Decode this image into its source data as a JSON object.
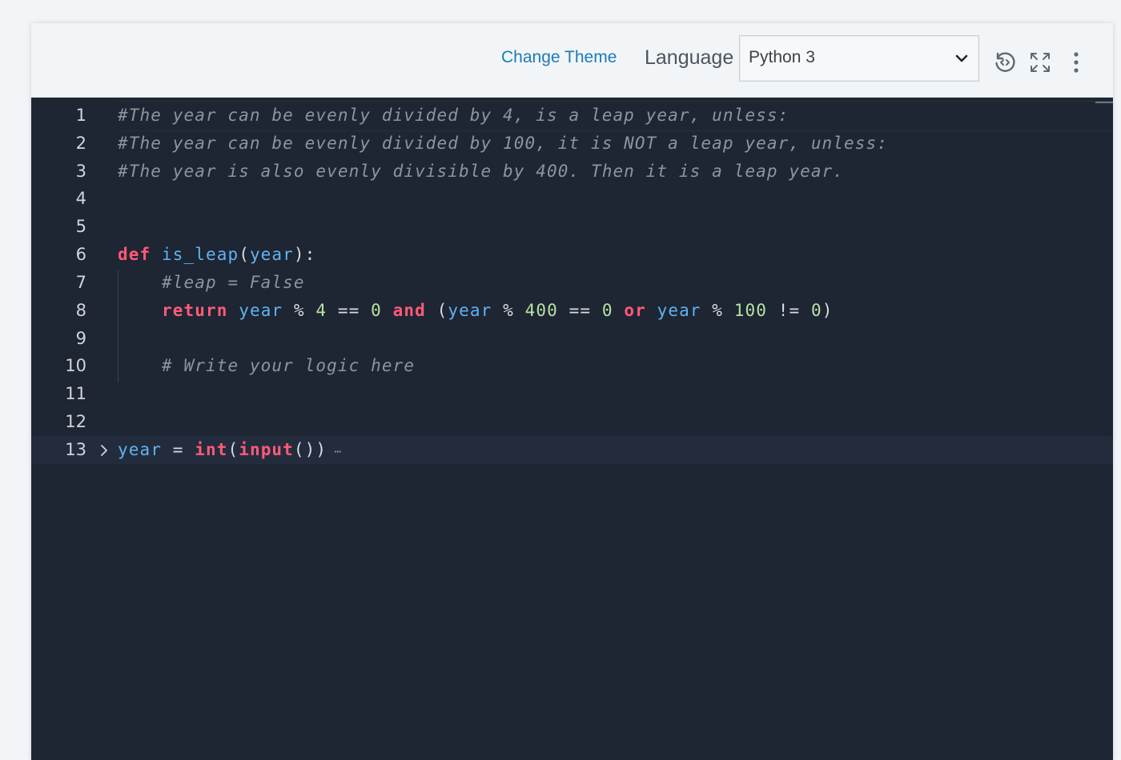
{
  "toolbar": {
    "change_theme": "Change Theme",
    "language_label": "Language",
    "language_value": "Python 3",
    "icons": [
      "restore-icon",
      "fullscreen-icon",
      "more-vertical-icon"
    ]
  },
  "editor": {
    "lines": [
      {
        "n": "1",
        "tokens": [
          [
            "c",
            "#The year can be evenly divided by 4, is a leap year, unless:"
          ]
        ]
      },
      {
        "n": "2",
        "tokens": [
          [
            "c",
            "#The year can be evenly divided by 100, it is NOT a leap year, unless:"
          ]
        ]
      },
      {
        "n": "3",
        "tokens": [
          [
            "c",
            "#The year is also evenly divisible by 400. Then it is a leap year."
          ]
        ]
      },
      {
        "n": "4",
        "tokens": []
      },
      {
        "n": "5",
        "tokens": []
      },
      {
        "n": "6",
        "tokens": [
          [
            "kw",
            "def"
          ],
          [
            "pl",
            " "
          ],
          [
            "fn",
            "is_leap"
          ],
          [
            "pl",
            "("
          ],
          [
            "id",
            "year"
          ],
          [
            "pl",
            "):"
          ]
        ]
      },
      {
        "n": "7",
        "tokens": [
          [
            "pl",
            "    "
          ],
          [
            "c",
            "#leap = False"
          ]
        ]
      },
      {
        "n": "8",
        "tokens": [
          [
            "pl",
            "    "
          ],
          [
            "kw",
            "return"
          ],
          [
            "pl",
            " "
          ],
          [
            "id",
            "year"
          ],
          [
            "pl",
            " % "
          ],
          [
            "nm",
            "4"
          ],
          [
            "pl",
            " == "
          ],
          [
            "nm",
            "0"
          ],
          [
            "pl",
            " "
          ],
          [
            "kw",
            "and"
          ],
          [
            "pl",
            " ("
          ],
          [
            "id",
            "year"
          ],
          [
            "pl",
            " % "
          ],
          [
            "nm",
            "400"
          ],
          [
            "pl",
            " == "
          ],
          [
            "nm",
            "0"
          ],
          [
            "pl",
            " "
          ],
          [
            "kw",
            "or"
          ],
          [
            "pl",
            " "
          ],
          [
            "id",
            "year"
          ],
          [
            "pl",
            " % "
          ],
          [
            "nm",
            "100"
          ],
          [
            "pl",
            " != "
          ],
          [
            "nm",
            "0"
          ],
          [
            "pl",
            ")"
          ]
        ]
      },
      {
        "n": "9",
        "tokens": []
      },
      {
        "n": "10",
        "tokens": [
          [
            "pl",
            "    "
          ],
          [
            "c",
            "# Write your logic here"
          ]
        ]
      },
      {
        "n": "11",
        "tokens": []
      },
      {
        "n": "12",
        "tokens": []
      },
      {
        "n": "13",
        "tokens": [
          [
            "id",
            "year"
          ],
          [
            "pl",
            " = "
          ],
          [
            "bi",
            "int"
          ],
          [
            "pl",
            "("
          ],
          [
            "bi",
            "input"
          ],
          [
            "pl",
            "())"
          ]
        ],
        "folded": true,
        "current": true
      }
    ],
    "fold_ellipsis": "⋯"
  },
  "colors": {
    "editor_bg": "#1e2533",
    "toolbar_bg": "#f2f5f7",
    "link": "#1a7bb9",
    "keyword": "#ff5a78",
    "identifier": "#5fb3f0",
    "number": "#b7e3a2",
    "comment": "#8c95a0"
  }
}
